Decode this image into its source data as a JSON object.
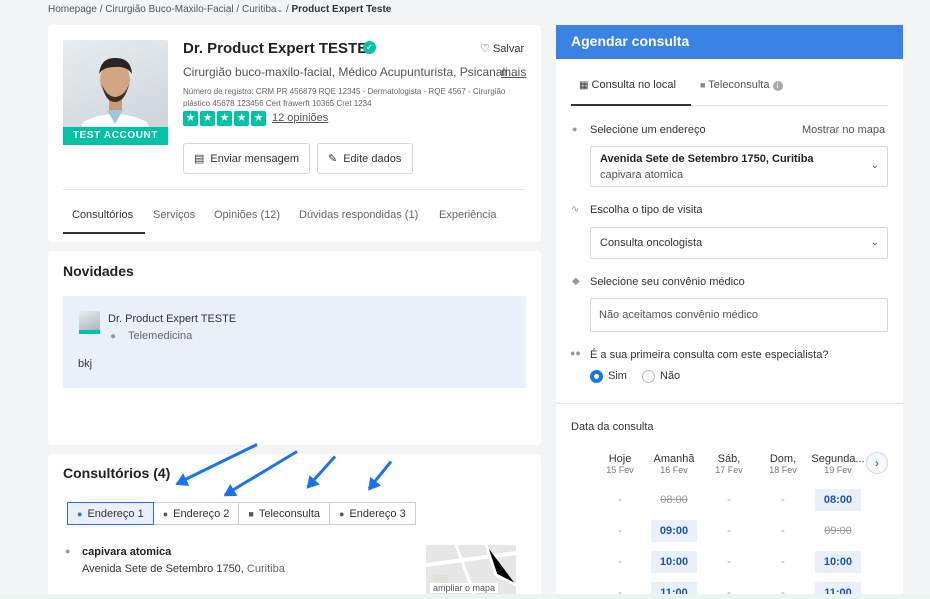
{
  "breadcrumb": {
    "items": [
      "Homepage",
      "Cirurgião Buco-Maxilo-Facial",
      "Curitiba",
      "Product Expert Teste"
    ],
    "separator": "/"
  },
  "profile": {
    "test_badge": "TEST ACCOUNT",
    "name": "Dr. Product Expert TESTE",
    "save_label": "Salvar",
    "specialties": "Cirurgião buco-maxilo-facial, Médico Acupunturista, Psicanali...",
    "more_label": "mais",
    "registration": "Número de registro: CRM PR 456879 RQE 12345 - Dermatologista - RQE 4567 - Cirurgião plástico 45678 123456 Cert frawerft 10365 Cret 1234",
    "rating_stars": 5,
    "opinions_link": "12 opiniões",
    "send_message": "Enviar mensagem",
    "edit_data": "Edite dados",
    "tabs": [
      "Consultórios",
      "Serviços",
      "Opiniões (12)",
      "Dúvidas respondidas (1)",
      "Experiência"
    ]
  },
  "news": {
    "title": "Novidades",
    "author": "Dr. Product Expert TESTE",
    "location": "Telemedicina",
    "text": "bkj"
  },
  "offices": {
    "title": "Consultórios (4)",
    "tabs": [
      "Endereço 1",
      "Endereço 2",
      "Teleconsulta",
      "Endereço 3"
    ],
    "active_tab": 0,
    "place_name": "capivara atomica",
    "street": "Avenida Sete de Setembro 1750, ",
    "city": "Curitiba",
    "map_label": "ampliar o mapa"
  },
  "booking": {
    "title": "Agendar consulta",
    "tab_local": "Consulta no local",
    "tab_tele": "Teleconsulta",
    "address_label": "Selecione um endereço",
    "show_map": "Mostrar no mapa",
    "address_value": "Avenida Sete de Setembro 1750, Curitiba",
    "address_sub": "capivara atomica",
    "visit_label": "Escolha o tipo de visita",
    "visit_value": "Consulta oncologista",
    "insurance_label": "Selecione seu convênio médico",
    "insurance_value": "Não aceitamos convênio médico",
    "first_visit_q": "É a sua primeira consulta com este especialista?",
    "yes": "Sim",
    "no": "Não",
    "date_label": "Data da consulta",
    "days": [
      {
        "name": "Hoje",
        "date": "15 Fev"
      },
      {
        "name": "Amanhã",
        "date": "16 Fev"
      },
      {
        "name": "Sáb,",
        "date": "17 Fev"
      },
      {
        "name": "Dom,",
        "date": "18 Fev"
      },
      {
        "name": "Segunda...",
        "date": "19 Fev"
      }
    ],
    "slots": [
      [
        {
          "t": "-",
          "s": "none"
        },
        {
          "t": "08:00",
          "s": "strike"
        },
        {
          "t": "-",
          "s": "none"
        },
        {
          "t": "-",
          "s": "none"
        },
        {
          "t": "08:00",
          "s": "avail"
        }
      ],
      [
        {
          "t": "-",
          "s": "none"
        },
        {
          "t": "09:00",
          "s": "avail"
        },
        {
          "t": "-",
          "s": "none"
        },
        {
          "t": "-",
          "s": "none"
        },
        {
          "t": "09:00",
          "s": "strike"
        }
      ],
      [
        {
          "t": "-",
          "s": "none"
        },
        {
          "t": "10:00",
          "s": "avail"
        },
        {
          "t": "-",
          "s": "none"
        },
        {
          "t": "-",
          "s": "none"
        },
        {
          "t": "10:00",
          "s": "avail"
        }
      ],
      [
        {
          "t": "-",
          "s": "none"
        },
        {
          "t": "11:00",
          "s": "avail"
        },
        {
          "t": "-",
          "s": "none"
        },
        {
          "t": "-",
          "s": "none"
        },
        {
          "t": "11:00",
          "s": "avail"
        }
      ]
    ]
  },
  "colors": {
    "accent": "#1a73e8",
    "header_blue": "#3b82e5",
    "teal": "#00c3a5"
  }
}
